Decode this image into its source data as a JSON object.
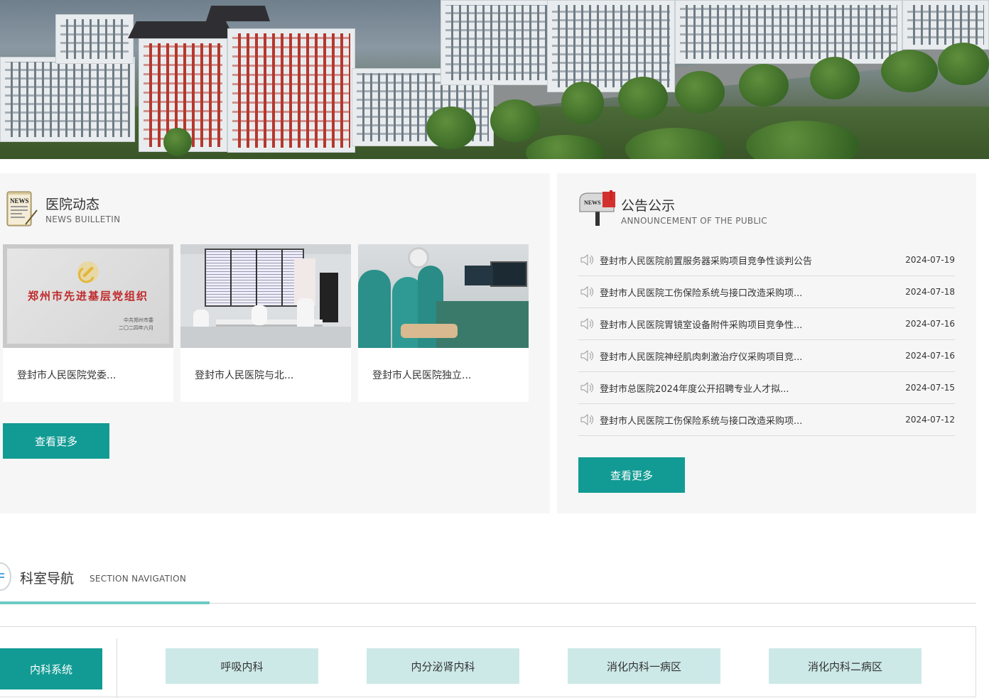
{
  "banner": {
    "image": "hospital-campus-aerial-photo"
  },
  "news": {
    "title": "医院动态",
    "subtitle": "NEWS BUILLETIN",
    "icon": "newspaper-icon",
    "cards": [
      {
        "caption": "登封市人民医院党委...",
        "image": "award-certificate-photo"
      },
      {
        "caption": "登封市人民医院与北...",
        "image": "monitoring-room-photo"
      },
      {
        "caption": "登封市人民医院独立...",
        "image": "surgery-photo"
      }
    ],
    "cert": {
      "text": "郑州市先进基层党组织",
      "org": "中共郑州市委",
      "date": "二〇二四年六月"
    },
    "more_label": "查看更多"
  },
  "notice": {
    "title": "公告公示",
    "subtitle": "ANNOUNCEMENT OF THE PUBLIC",
    "icon": "mailbox-icon",
    "items": [
      {
        "title": "登封市人民医院前置服务器采购项目竞争性谈判公告",
        "date": "2024-07-19"
      },
      {
        "title": "登封市人民医院工伤保险系统与接口改造采购项...",
        "date": "2024-07-18"
      },
      {
        "title": "登封市人民医院胃镜室设备附件采购项目竞争性...",
        "date": "2024-07-16"
      },
      {
        "title": "登封市人民医院神经肌肉刺激治疗仪采购项目竞...",
        "date": "2024-07-16"
      },
      {
        "title": "登封市总医院2024年度公开招聘专业人才拟...",
        "date": "2024-07-15"
      },
      {
        "title": "登封市人民医院工伤保险系统与接口改造采购项...",
        "date": "2024-07-12"
      }
    ],
    "more_label": "查看更多"
  },
  "section_nav": {
    "title": "科室导航",
    "subtitle": "SECTION NAVIGATION",
    "active_category": "内科系统",
    "departments": [
      "呼吸内科",
      "内分泌肾内科",
      "消化内科一病区",
      "消化内科二病区"
    ]
  },
  "colors": {
    "accent": "#129b94",
    "dept_bg": "#cce9e8",
    "panel_bg": "#f6f6f6",
    "underline": "#6bcac4"
  }
}
